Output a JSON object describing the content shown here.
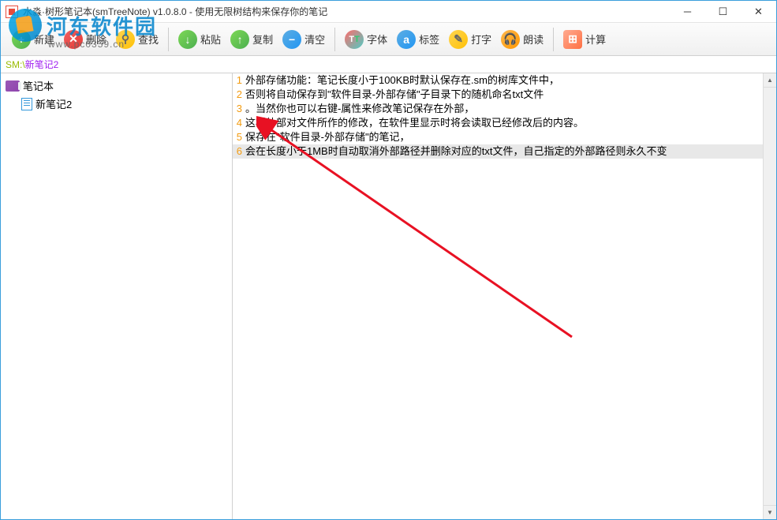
{
  "window": {
    "title": "水淼·树形笔记本(smTreeNote) v1.0.8.0 - 使用无限树结构来保存你的笔记"
  },
  "watermark": {
    "text": "河东软件园",
    "sub": "www.pc0359.cn"
  },
  "toolbar": {
    "new": "新建",
    "delete": "删除",
    "find": "查找",
    "paste": "粘贴",
    "copy": "复制",
    "clear": "清空",
    "font": "字体",
    "tag": "标签",
    "type": "打字",
    "read": "朗读",
    "calc": "计算"
  },
  "breadcrumb": {
    "prefix": "SM:\\ ",
    "path": "新笔记2"
  },
  "tree": {
    "root": "笔记本",
    "items": [
      "新笔记2"
    ]
  },
  "editor": {
    "lines": [
      {
        "num": 1,
        "text": "外部存储功能：笔记长度小于100KB时默认保存在.sm的树库文件中，"
      },
      {
        "num": 2,
        "text": "否则将自动保存到\"软件目录-外部存储\"子目录下的随机命名txt文件"
      },
      {
        "num": 3,
        "text": "。当然你也可以右键-属性来修改笔记保存在外部，"
      },
      {
        "num": 4,
        "text": "这样外部对文件所作的修改，在软件里显示时将会读取已经修改后的内容。"
      },
      {
        "num": 5,
        "text": "保存在\"软件目录-外部存储\"的笔记，"
      },
      {
        "num": 6,
        "text": "会在长度小于1MB时自动取消外部路径并删除对应的txt文件，自己指定的外部路径则永久不变",
        "highlight": true
      }
    ]
  }
}
